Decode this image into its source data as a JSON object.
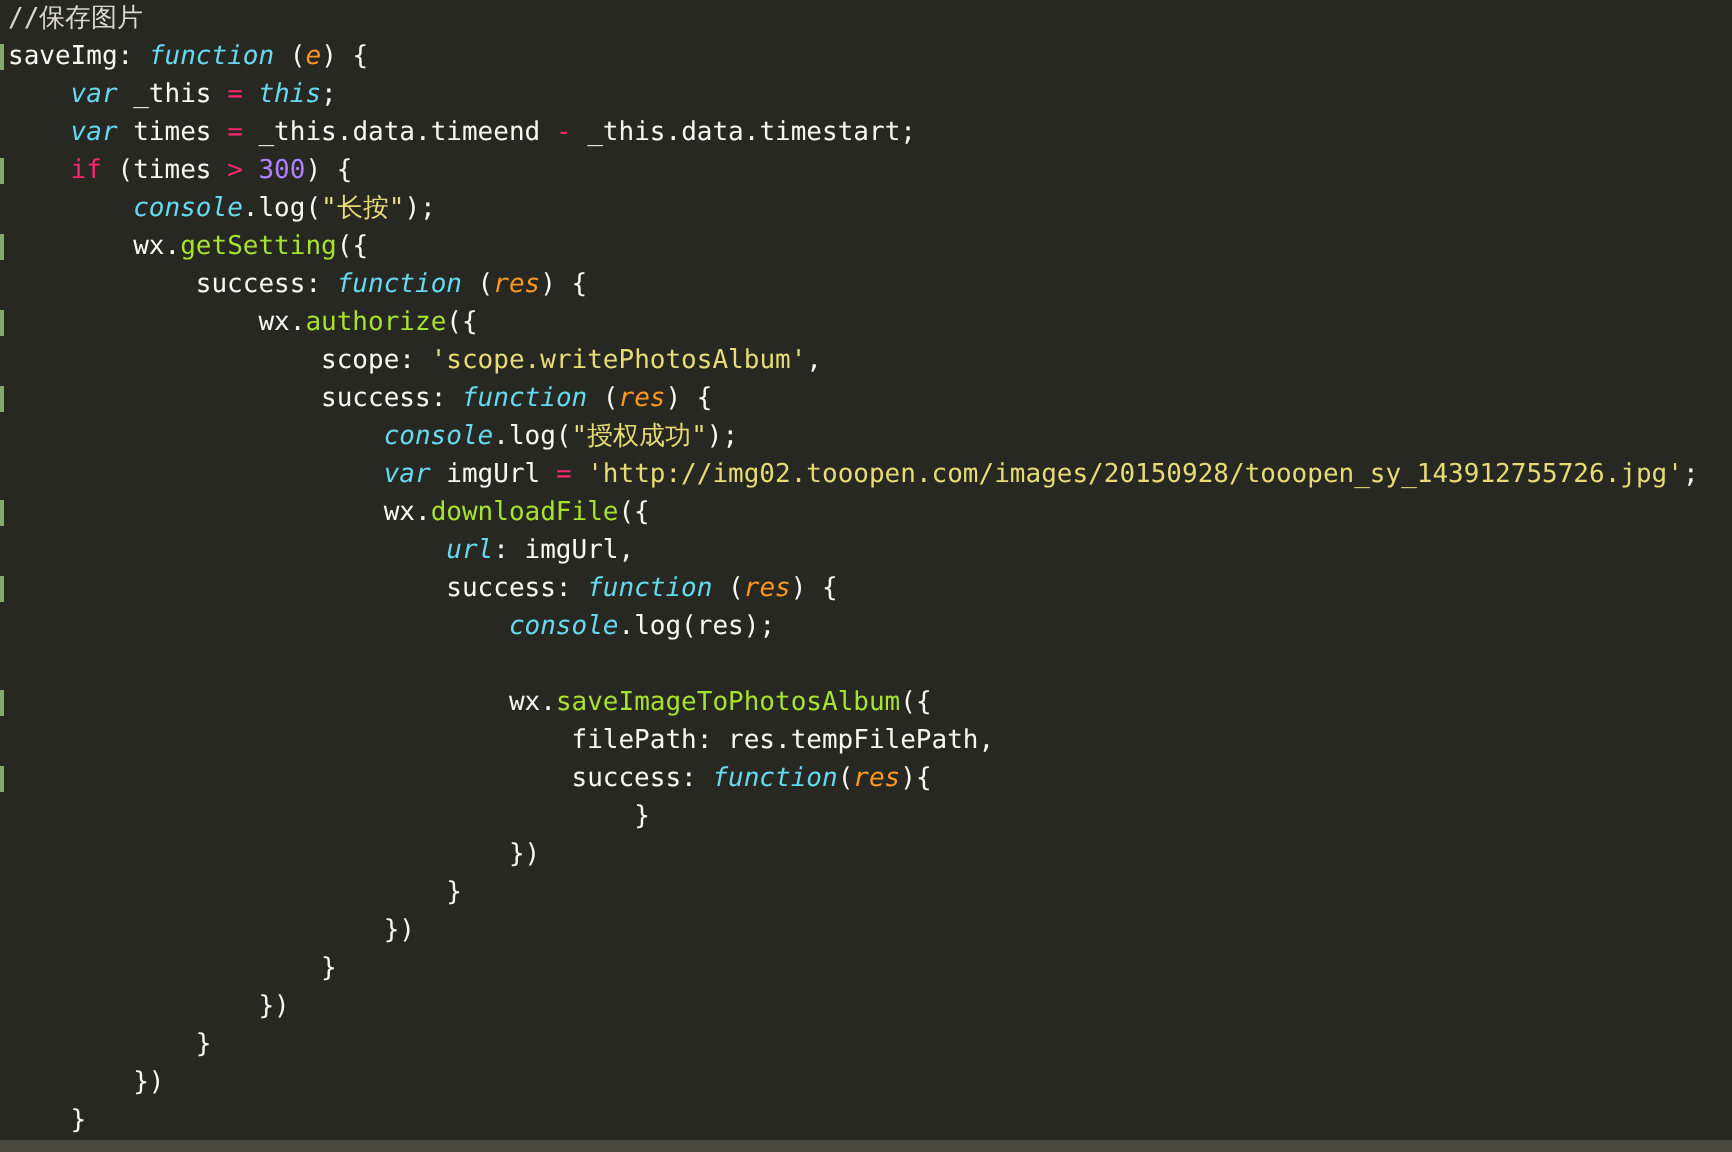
{
  "editor": {
    "lines": [
      {
        "marked": false,
        "highlighted": false,
        "tokens": [
          {
            "kind": "comment",
            "text": "//保存图片"
          }
        ]
      },
      {
        "marked": true,
        "highlighted": false,
        "tokens": [
          {
            "kind": "plain",
            "text": "saveImg: "
          },
          {
            "kind": "keyword",
            "text": "function"
          },
          {
            "kind": "plain",
            "text": " ("
          },
          {
            "kind": "param",
            "text": "e"
          },
          {
            "kind": "plain",
            "text": ") {"
          }
        ],
        "children": [
          {
            "marked": false,
            "highlighted": false,
            "tokens": [
              {
                "kind": "keyword",
                "text": "var"
              },
              {
                "kind": "plain",
                "text": " _this "
              },
              {
                "kind": "operator",
                "text": "= "
              },
              {
                "kind": "keyword",
                "text": "this"
              },
              {
                "kind": "plain",
                "text": ";"
              }
            ]
          },
          {
            "marked": false,
            "highlighted": false,
            "tokens": [
              {
                "kind": "keyword",
                "text": "var"
              },
              {
                "kind": "plain",
                "text": " times "
              },
              {
                "kind": "operator",
                "text": "="
              },
              {
                "kind": "plain",
                "text": " _this.data.timeend "
              },
              {
                "kind": "operator",
                "text": "-"
              },
              {
                "kind": "plain",
                "text": " _this.data.timestart;"
              }
            ]
          },
          {
            "marked": true,
            "highlighted": false,
            "tokens": [
              {
                "kind": "operator",
                "text": "if"
              },
              {
                "kind": "plain",
                "text": " (times "
              },
              {
                "kind": "operator",
                "text": "> "
              },
              {
                "kind": "number",
                "text": "300"
              },
              {
                "kind": "plain",
                "text": ") {"
              }
            ],
            "children": [
              {
                "marked": false,
                "highlighted": false,
                "tokens": [
                  {
                    "kind": "keyword",
                    "text": "console"
                  },
                  {
                    "kind": "plain",
                    "text": ".log("
                  },
                  {
                    "kind": "string",
                    "text": "\"长按\""
                  },
                  {
                    "kind": "plain",
                    "text": ");"
                  }
                ]
              },
              {
                "marked": true,
                "highlighted": false,
                "tokens": [
                  {
                    "kind": "plain",
                    "text": "wx."
                  },
                  {
                    "kind": "function",
                    "text": "getSetting"
                  },
                  {
                    "kind": "plain",
                    "text": "({"
                  }
                ],
                "children": [
                  {
                    "marked": false,
                    "highlighted": false,
                    "tokens": [
                      {
                        "kind": "plain",
                        "text": "success: "
                      },
                      {
                        "kind": "keyword",
                        "text": "function"
                      },
                      {
                        "kind": "plain",
                        "text": " ("
                      },
                      {
                        "kind": "param",
                        "text": "res"
                      },
                      {
                        "kind": "plain",
                        "text": ") {"
                      }
                    ],
                    "children": [
                      {
                        "marked": true,
                        "highlighted": false,
                        "tokens": [
                          {
                            "kind": "plain",
                            "text": "wx."
                          },
                          {
                            "kind": "function",
                            "text": "authorize"
                          },
                          {
                            "kind": "plain",
                            "text": "({"
                          }
                        ],
                        "children": [
                          {
                            "marked": false,
                            "highlighted": false,
                            "tokens": [
                              {
                                "kind": "plain",
                                "text": "scope: "
                              },
                              {
                                "kind": "string",
                                "text": "'scope.writePhotosAlbum'"
                              },
                              {
                                "kind": "plain",
                                "text": ","
                              }
                            ]
                          },
                          {
                            "marked": true,
                            "highlighted": false,
                            "tokens": [
                              {
                                "kind": "plain",
                                "text": "success: "
                              },
                              {
                                "kind": "keyword",
                                "text": "function"
                              },
                              {
                                "kind": "plain",
                                "text": " ("
                              },
                              {
                                "kind": "param",
                                "text": "res"
                              },
                              {
                                "kind": "plain",
                                "text": ") {"
                              }
                            ],
                            "children": [
                              {
                                "marked": false,
                                "highlighted": false,
                                "tokens": [
                                  {
                                    "kind": "keyword",
                                    "text": "console"
                                  },
                                  {
                                    "kind": "plain",
                                    "text": ".log("
                                  },
                                  {
                                    "kind": "string",
                                    "text": "\"授权成功\""
                                  },
                                  {
                                    "kind": "plain",
                                    "text": ");"
                                  }
                                ]
                              },
                              {
                                "marked": false,
                                "highlighted": false,
                                "tokens": [
                                  {
                                    "kind": "keyword",
                                    "text": "var"
                                  },
                                  {
                                    "kind": "plain",
                                    "text": " imgUrl "
                                  },
                                  {
                                    "kind": "operator",
                                    "text": "= "
                                  },
                                  {
                                    "kind": "string",
                                    "text": "'http://img02.tooopen.com/images/20150928/tooopen_sy_143912755726.jpg'"
                                  },
                                  {
                                    "kind": "plain",
                                    "text": ";"
                                  }
                                ]
                              },
                              {
                                "marked": true,
                                "highlighted": false,
                                "tokens": [
                                  {
                                    "kind": "plain",
                                    "text": "wx."
                                  },
                                  {
                                    "kind": "function",
                                    "text": "downloadFile"
                                  },
                                  {
                                    "kind": "plain",
                                    "text": "({"
                                  }
                                ],
                                "children": [
                                  {
                                    "marked": false,
                                    "highlighted": false,
                                    "tokens": [
                                      {
                                        "kind": "keyword",
                                        "text": "url"
                                      },
                                      {
                                        "kind": "plain",
                                        "text": ": imgUrl,"
                                      }
                                    ]
                                  },
                                  {
                                    "marked": true,
                                    "highlighted": false,
                                    "tokens": [
                                      {
                                        "kind": "plain",
                                        "text": "success: "
                                      },
                                      {
                                        "kind": "keyword",
                                        "text": "function"
                                      },
                                      {
                                        "kind": "plain",
                                        "text": " ("
                                      },
                                      {
                                        "kind": "param",
                                        "text": "res"
                                      },
                                      {
                                        "kind": "plain",
                                        "text": ") {"
                                      }
                                    ],
                                    "children": [
                                      {
                                        "marked": false,
                                        "highlighted": false,
                                        "tokens": [
                                          {
                                            "kind": "keyword",
                                            "text": "console"
                                          },
                                          {
                                            "kind": "plain",
                                            "text": ".log(res);"
                                          }
                                        ]
                                      },
                                      {
                                        "marked": false,
                                        "highlighted": false
                                      },
                                      {
                                        "marked": true,
                                        "highlighted": false,
                                        "tokens": [
                                          {
                                            "kind": "plain",
                                            "text": "wx."
                                          },
                                          {
                                            "kind": "function",
                                            "text": "saveImageToPhotosAlbum"
                                          },
                                          {
                                            "kind": "plain",
                                            "text": "({"
                                          }
                                        ],
                                        "children": [
                                          {
                                            "marked": false,
                                            "highlighted": false,
                                            "tokens": [
                                              {
                                                "kind": "plain",
                                                "text": "filePath: res.tempFilePath,"
                                              }
                                            ]
                                          },
                                          {
                                            "marked": true,
                                            "highlighted": false,
                                            "tokens": [
                                              {
                                                "kind": "plain",
                                                "text": "success: "
                                              },
                                              {
                                                "kind": "keyword",
                                                "text": "function"
                                              },
                                              {
                                                "kind": "plain",
                                                "text": "("
                                              },
                                              {
                                                "kind": "param",
                                                "text": "res"
                                              },
                                              {
                                                "kind": "plain",
                                                "text": "){"
                                              }
                                            ],
                                            "children": [
                                              {
                                                "marked": false,
                                                "highlighted": false,
                                                "tokens": [
                                                  {
                                                    "kind": "plain",
                                                    "text": "}"
                                                  }
                                                ]
                                              }
                                            ]
                                          }
                                        ]
                                      },
                                      {
                                        "marked": false,
                                        "highlighted": false,
                                        "tokens": [
                                          {
                                            "kind": "plain",
                                            "text": "})"
                                          }
                                        ]
                                      }
                                    ]
                                  },
                                  {
                                    "marked": false,
                                    "highlighted": false,
                                    "tokens": [
                                      {
                                        "kind": "plain",
                                        "text": "}"
                                      }
                                    ]
                                  }
                                ]
                              },
                              {
                                "marked": false,
                                "highlighted": false,
                                "tokens": [
                                  {
                                    "kind": "plain",
                                    "text": "})"
                                  }
                                ]
                              }
                            ]
                          },
                          {
                            "marked": false,
                            "highlighted": false,
                            "tokens": [
                              {
                                "kind": "plain",
                                "text": "}"
                              }
                            ]
                          }
                        ]
                      },
                      {
                        "marked": false,
                        "highlighted": false,
                        "tokens": [
                          {
                            "kind": "plain",
                            "text": "})"
                          }
                        ]
                      }
                    ]
                  },
                  {
                    "marked": false,
                    "highlighted": false,
                    "tokens": [
                      {
                        "kind": "plain",
                        "text": "}"
                      }
                    ]
                  }
                ]
              },
              {
                "marked": false,
                "highlighted": false,
                "tokens": [
                  {
                    "kind": "plain",
                    "text": "})"
                  }
                ]
              }
            ]
          },
          {
            "marked": false,
            "highlighted": false,
            "tokens": [
              {
                "kind": "plain",
                "text": "}"
              }
            ]
          }
        ]
      },
      {
        "marked": false,
        "highlighted": true
      }
    ]
  }
}
